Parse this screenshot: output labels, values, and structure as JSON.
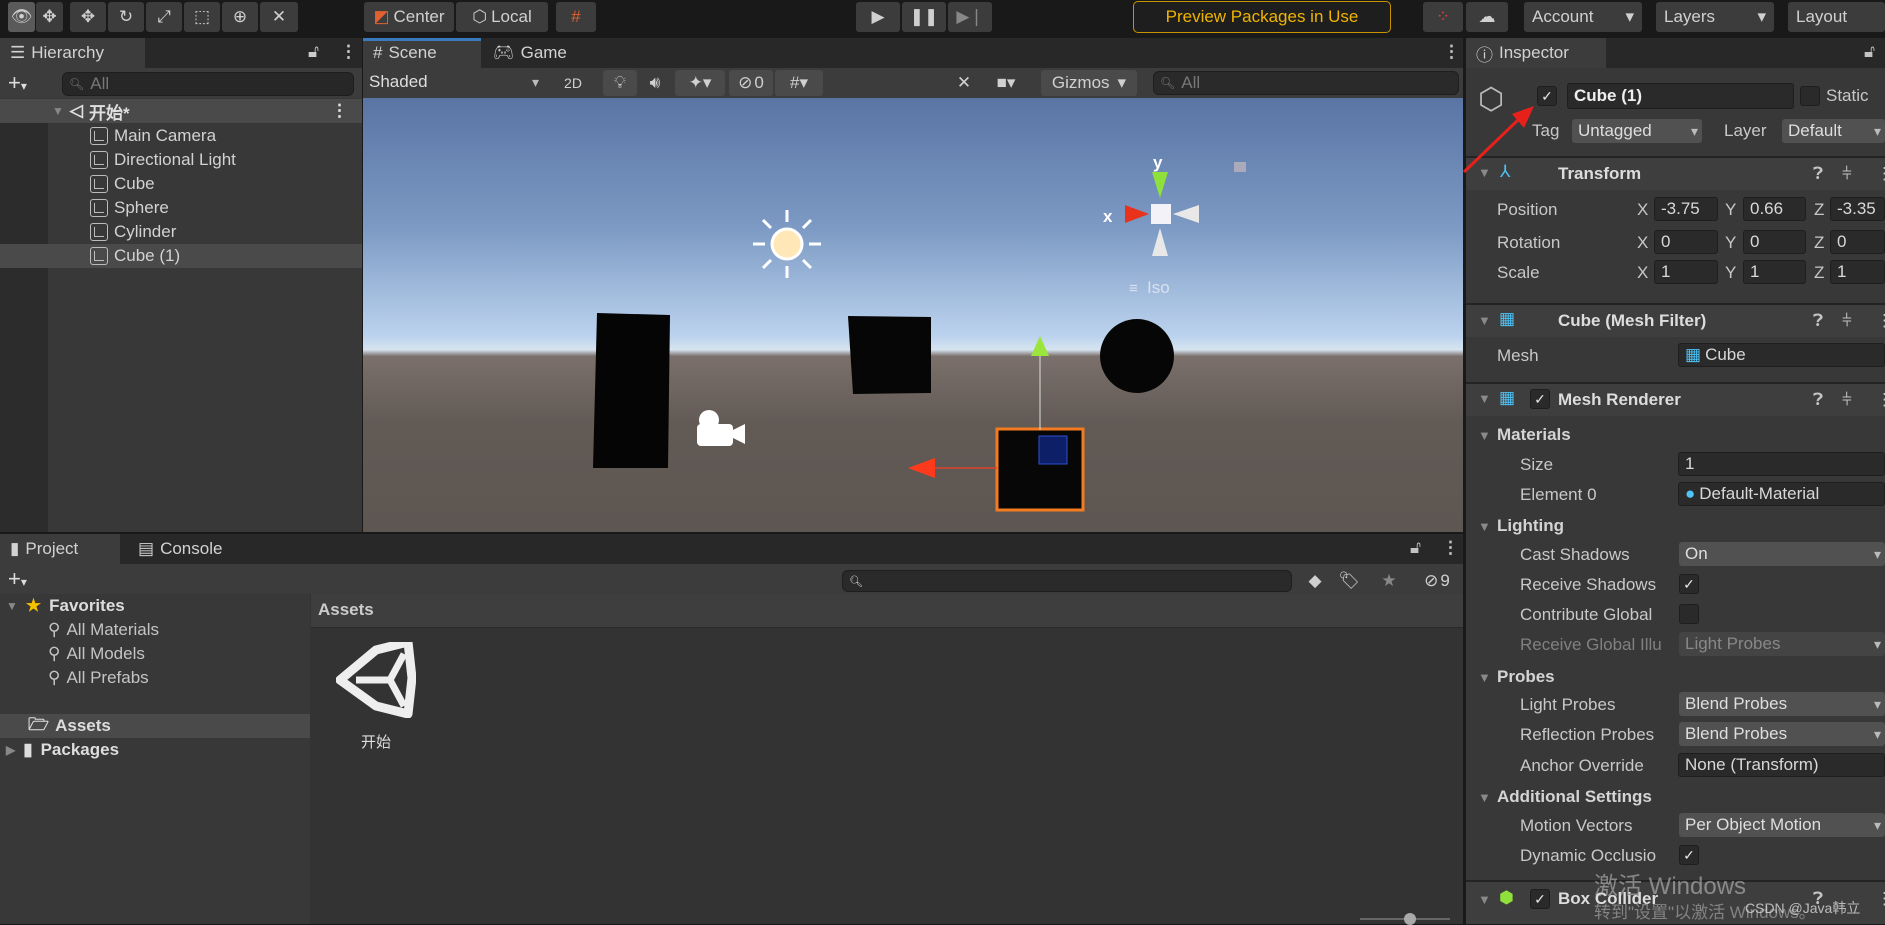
{
  "toolbar": {
    "tools": [
      "view-tool",
      "move-tool",
      "rotate-tool",
      "scale-tool",
      "rect-tool",
      "transform-tool",
      "custom-tool"
    ],
    "pivot": "Center",
    "space": "Local",
    "preview_packages": "Preview Packages in Use",
    "account": "Account",
    "layers": "Layers",
    "layout": "Layout",
    "accent": "#f0b400"
  },
  "hierarchy": {
    "tab": "Hierarchy",
    "search_placeholder": "All",
    "scene": "开始*",
    "items": [
      "Main Camera",
      "Directional Light",
      "Cube",
      "Sphere",
      "Cylinder",
      "Cube (1)"
    ],
    "selected": "Cube (1)"
  },
  "scene": {
    "tab_scene": "Scene",
    "tab_game": "Game",
    "shading": "Shaded",
    "mode_2d": "2D",
    "hidden_count": "0",
    "gizmos": "Gizmos",
    "search_placeholder": "All",
    "axis_x": "x",
    "axis_y": "y",
    "projection": "Iso"
  },
  "project": {
    "tab_project": "Project",
    "tab_console": "Console",
    "favorites": "Favorites",
    "fav_items": [
      "All Materials",
      "All Models",
      "All Prefabs"
    ],
    "assets": "Assets",
    "packages": "Packages",
    "breadcrumb": "Assets",
    "asset_items": [
      "开始"
    ],
    "hidden_count": "9"
  },
  "inspector": {
    "tab": "Inspector",
    "name": "Cube (1)",
    "active": true,
    "static": "Static",
    "tag_label": "Tag",
    "tag": "Untagged",
    "layer_label": "Layer",
    "layer": "Default",
    "transform": {
      "title": "Transform",
      "position_label": "Position",
      "rotation_label": "Rotation",
      "scale_label": "Scale",
      "position": [
        "-3.75",
        "0.66",
        "-3.35"
      ],
      "rotation": [
        "0",
        "0",
        "0"
      ],
      "scale": [
        "1",
        "1",
        "1"
      ],
      "axes": [
        "X",
        "Y",
        "Z"
      ]
    },
    "mesh_filter": {
      "title": "Cube (Mesh Filter)",
      "mesh_label": "Mesh",
      "mesh": "Cube"
    },
    "mesh_renderer": {
      "title": "Mesh Renderer",
      "materials": "Materials",
      "size_label": "Size",
      "size": "1",
      "element0_label": "Element 0",
      "element0": "Default-Material",
      "lighting": "Lighting",
      "cast_shadows_label": "Cast Shadows",
      "cast_shadows": "On",
      "receive_shadows_label": "Receive Shadows",
      "receive_shadows": true,
      "contribute_gi_label": "Contribute Global",
      "contribute_gi": false,
      "receive_gi_label": "Receive Global Illu",
      "receive_gi": "Light Probes",
      "probes": "Probes",
      "light_probes_label": "Light Probes",
      "light_probes": "Blend Probes",
      "reflection_probes_label": "Reflection Probes",
      "reflection_probes": "Blend Probes",
      "anchor_label": "Anchor Override",
      "anchor": "None (Transform)",
      "additional": "Additional Settings",
      "motion_vectors_label": "Motion Vectors",
      "motion_vectors": "Per Object Motion",
      "dynamic_occlusion_label": "Dynamic Occlusio",
      "dynamic_occlusion": true
    },
    "box_collider": {
      "title": "Box Collider"
    }
  },
  "watermark": {
    "line1": "激活 Windows",
    "line2": "转到\"设置\"以激活 Windows。",
    "csdn": "CSDN @Java韩立"
  },
  "colors": {
    "annotation_arrow": "#e8201c",
    "selection_outline": "#f47b20"
  }
}
